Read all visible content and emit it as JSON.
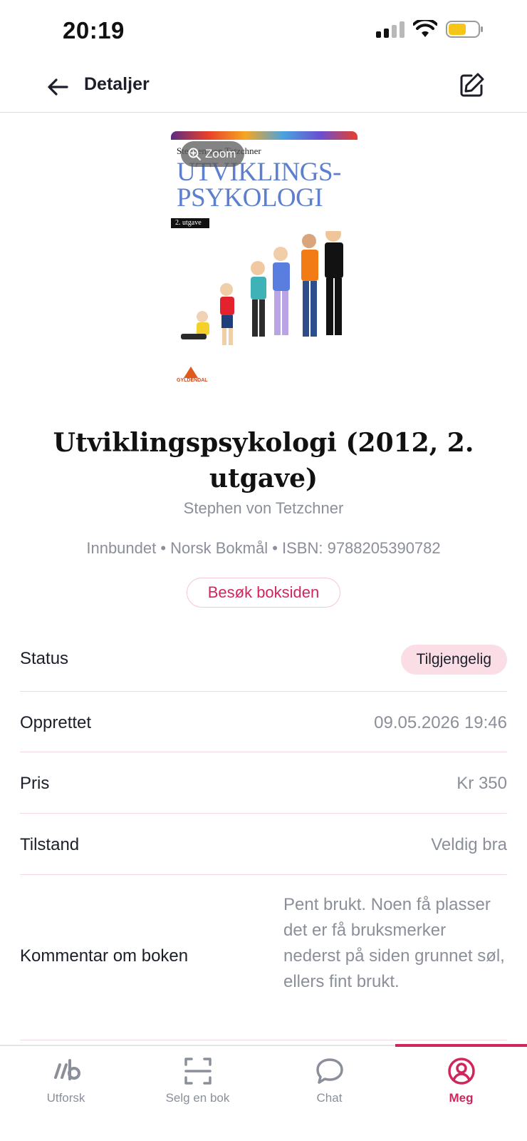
{
  "status_bar": {
    "time": "20:19"
  },
  "header": {
    "title": "Detaljer",
    "back_icon": "arrow-left-icon",
    "edit_icon": "edit-icon"
  },
  "cover": {
    "author_text": "Stephen von Tetzchner",
    "title_line1": "UTVIKLINGS-",
    "title_line2": "PSYKOLOGI",
    "edition_label": "2. utgave",
    "publisher": "GYLDENDAL",
    "zoom_label": "Zoom"
  },
  "book": {
    "title": "Utviklingspsykologi (2012, 2. utgave)",
    "author": "Stephen von Tetzchner",
    "meta": "Innbundet • Norsk Bokmål • ISBN: 9788205390782",
    "visit_label": "Besøk boksiden"
  },
  "details": {
    "status_label": "Status",
    "status_value": "Tilgjengelig",
    "created_label": "Opprettet",
    "created_value": "09.05.2026 19:46",
    "price_label": "Pris",
    "price_value": "Kr 350",
    "condition_label": "Tilstand",
    "condition_value": "Veldig bra",
    "comment_label": "Kommentar om boken",
    "comment_value": "Pent brukt. Noen få plasser det er få bruksmerker nederst på siden grunnet søl, ellers fint brukt."
  },
  "nav": {
    "items": [
      {
        "label": "Utforsk",
        "icon": "lb-logo-icon"
      },
      {
        "label": "Selg en bok",
        "icon": "scan-icon"
      },
      {
        "label": "Chat",
        "icon": "chat-bubble-icon"
      },
      {
        "label": "Meg",
        "icon": "user-circle-icon"
      }
    ],
    "active_index": 3
  },
  "colors": {
    "accent": "#d0265b",
    "badge_bg": "#fbdde5",
    "muted_text": "#8a8f99"
  }
}
